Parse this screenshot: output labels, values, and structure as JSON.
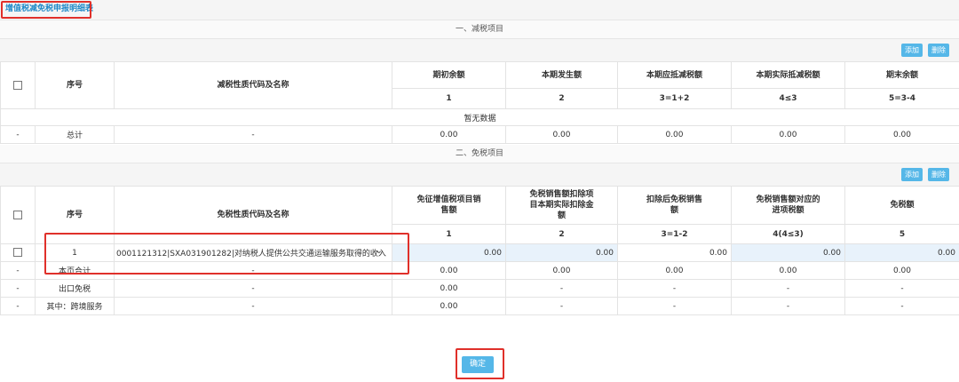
{
  "tab_title": "增值税减免税申报明细表",
  "section1": {
    "title": "一、减税项目",
    "add_label": "添加",
    "delete_label": "删除",
    "headers": [
      "序号",
      "减税性质代码及名称",
      "期初余额",
      "本期发生额",
      "本期应抵减税额",
      "本期实际抵减税额",
      "期末余额"
    ],
    "col_nums": [
      "1",
      "2",
      "3=1+2",
      "4≤3",
      "5=3-4"
    ],
    "empty_text": "暂无数据",
    "total_row": [
      "-",
      "总计",
      "-",
      "0.00",
      "0.00",
      "0.00",
      "0.00",
      "0.00"
    ]
  },
  "section2": {
    "title": "二、免税项目",
    "add_label": "添加",
    "delete_label": "删除",
    "headers": [
      "序号",
      "免税性质代码及名称",
      "免征增值税项目销售额",
      "免税销售额扣除项目本期实际扣除金额",
      "扣除后免税销售额",
      "免税销售额对应的进项税额",
      "免税额"
    ],
    "col_nums": [
      "1",
      "2",
      "3=1-2",
      "4(4≤3)",
      "5"
    ],
    "entry_row": {
      "seq": "1",
      "code": "0001121312|SXA031901282|对纳税人提供公共交通运输服务取得的收入",
      "values": [
        "0.00",
        "0.00",
        "0.00",
        "0.00",
        "0.00"
      ]
    },
    "rows": [
      [
        "-",
        "本页合计",
        "-",
        "0.00",
        "0.00",
        "0.00",
        "0.00",
        "0.00"
      ],
      [
        "-",
        "出口免税",
        "-",
        "0.00",
        "-",
        "-",
        "-",
        "-"
      ],
      [
        "-",
        "其中：跨境服务",
        "-",
        "0.00",
        "-",
        "-",
        "-",
        "-"
      ]
    ]
  },
  "confirm_label": "确定"
}
